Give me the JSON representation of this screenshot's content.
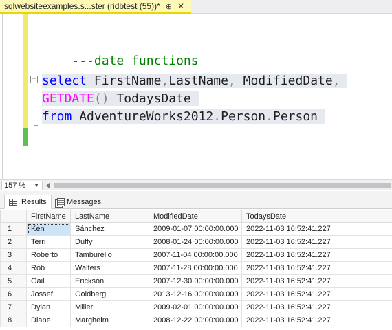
{
  "document_tab": {
    "title": "sqlwebsiteexamples.s...ster (ridbtest (55))*",
    "pin_glyph": "⊕",
    "close_glyph": "✕"
  },
  "editor": {
    "comment": "---date functions",
    "line1": {
      "kw1": "select",
      "c1": "FirstName",
      "p1": ",",
      "c2": "LastName",
      "p2": ",",
      "c3": "ModifiedDate",
      "p3": ","
    },
    "line2": {
      "fn": "GETDATE",
      "paren": "()",
      "alias": "TodaysDate"
    },
    "line3": {
      "kw": "from",
      "db": "AdventureWorks2012",
      "d1": ".",
      "schema": "Person",
      "d2": ".",
      "table": "Person"
    },
    "fold_glyph": "−"
  },
  "zoom": {
    "value": "157 %",
    "arrow_glyph": "▼"
  },
  "results_tabs": {
    "results": "Results",
    "messages": "Messages"
  },
  "grid": {
    "columns": [
      "",
      "FirstName",
      "LastName",
      "ModifiedDate",
      "TodaysDate"
    ],
    "rows": [
      [
        "1",
        "Ken",
        "Sánchez",
        "2009-01-07 00:00:00.000",
        "2022-11-03 16:52:41.227"
      ],
      [
        "2",
        "Terri",
        "Duffy",
        "2008-01-24 00:00:00.000",
        "2022-11-03 16:52:41.227"
      ],
      [
        "3",
        "Roberto",
        "Tamburello",
        "2007-11-04 00:00:00.000",
        "2022-11-03 16:52:41.227"
      ],
      [
        "4",
        "Rob",
        "Walters",
        "2007-11-28 00:00:00.000",
        "2022-11-03 16:52:41.227"
      ],
      [
        "5",
        "Gail",
        "Erickson",
        "2007-12-30 00:00:00.000",
        "2022-11-03 16:52:41.227"
      ],
      [
        "6",
        "Jossef",
        "Goldberg",
        "2013-12-16 00:00:00.000",
        "2022-11-03 16:52:41.227"
      ],
      [
        "7",
        "Dylan",
        "Miller",
        "2009-02-01 00:00:00.000",
        "2022-11-03 16:52:41.227"
      ],
      [
        "8",
        "Diane",
        "Margheim",
        "2008-12-22 00:00:00.000",
        "2022-11-03 16:52:41.227"
      ]
    ]
  },
  "colors": {
    "keyword": "#0000ff",
    "function": "#ff00ff",
    "comment": "#008000",
    "tab_active": "#fff9b8",
    "change_bar": "#f0ea6e",
    "saved_bar": "#5bc250"
  }
}
